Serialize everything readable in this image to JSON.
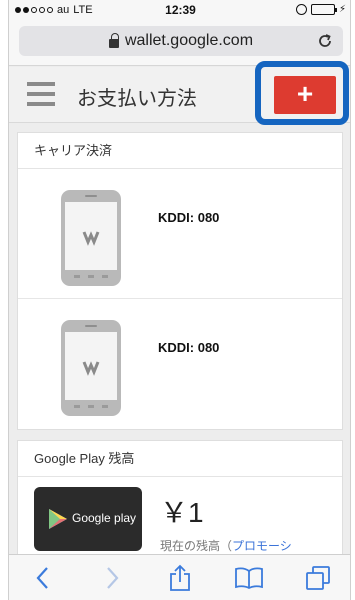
{
  "status_bar": {
    "carrier": "au",
    "network": "LTE",
    "time": "12:39"
  },
  "browser": {
    "url": "wallet.google.com"
  },
  "header": {
    "title": "お支払い方法",
    "add_label": "+"
  },
  "sections": {
    "carrier": {
      "title": "キャリア決済",
      "items": [
        {
          "label": "KDDI: 080"
        },
        {
          "label": "KDDI: 080"
        }
      ]
    },
    "google_play": {
      "title": "Google Play 残高",
      "card_text": "Google play",
      "amount": "￥1",
      "sub_prefix": "現在の残高（",
      "sub_link": "プロモーシ"
    }
  },
  "colors": {
    "accent": "#dd3b30",
    "highlight": "#1565c0",
    "toolbar_icon": "#3b7bdc"
  },
  "icons": {
    "back": "chevron-left-icon",
    "forward": "chevron-right-icon",
    "share": "share-icon",
    "bookmarks": "book-icon",
    "tabs": "tabs-icon"
  }
}
